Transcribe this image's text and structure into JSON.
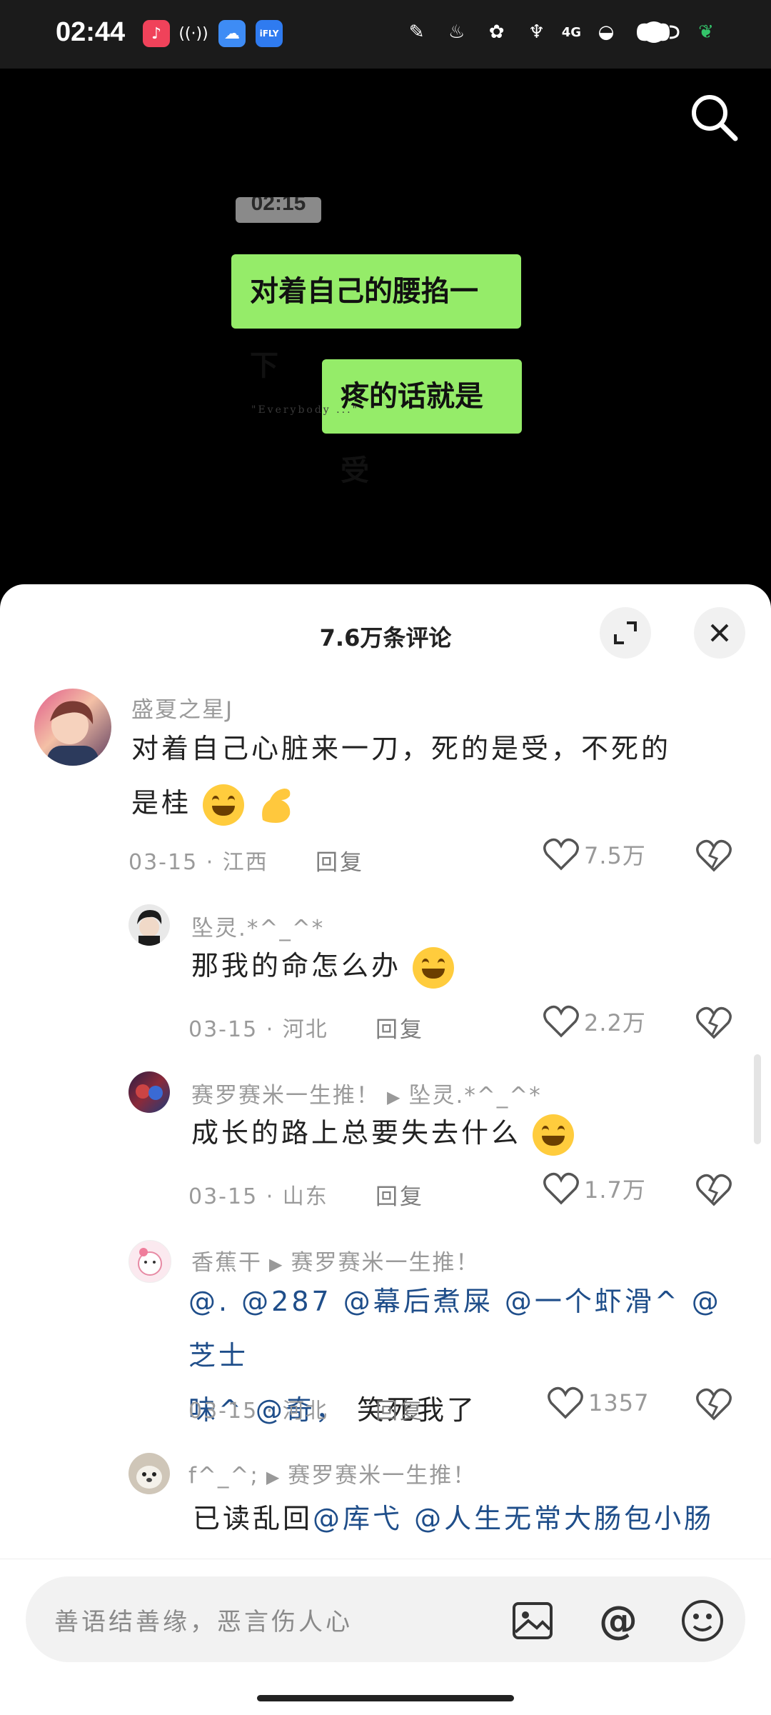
{
  "status_bar": {
    "time": "02:44",
    "network": "4G"
  },
  "video": {
    "chat_time": "02:15",
    "bubble_1": "对着自己的腰掐一下",
    "bubble_2": "疼的话就是受",
    "watermark": "\"Everybody ...\""
  },
  "sheet": {
    "title": "7.6万条评论"
  },
  "comments": [
    {
      "user": "盛夏之星J",
      "text_line1": "对着自己心脏来一刀，死的是受，不死的",
      "text_line2": "是桂",
      "date_loc": "03-15 · 江西",
      "reply": "回复",
      "likes": "7.5万"
    },
    {
      "user": "坠灵.*^_^*",
      "text": "那我的命怎么办",
      "date_loc": "03-15 · 河北",
      "reply": "回复",
      "likes": "2.2万"
    },
    {
      "user": "赛罗赛米一生推！",
      "reply_to": "坠灵.*^_^*",
      "text": "成长的路上总要失去什么",
      "date_loc": "03-15 · 山东",
      "reply": "回复",
      "likes": "1.7万"
    },
    {
      "user": "香蕉干",
      "reply_to": "赛罗赛米一生推！",
      "mentions_line1": "@. @287 @幕后煮屎 @一个虾滑^ @芝士",
      "mentions_line2": "味^ @奇，",
      "text_tail": " 笑死我了",
      "date_loc": "03-15 · 河北",
      "reply": "回复",
      "likes": "1357"
    },
    {
      "user": "f^_^;",
      "reply_to": "赛罗赛米一生推！",
      "text_prefix": "已读乱回",
      "mentions": "@库弋 @人生无常大肠包小肠"
    }
  ],
  "input": {
    "placeholder": "善语结善缘，恶言伤人心"
  }
}
